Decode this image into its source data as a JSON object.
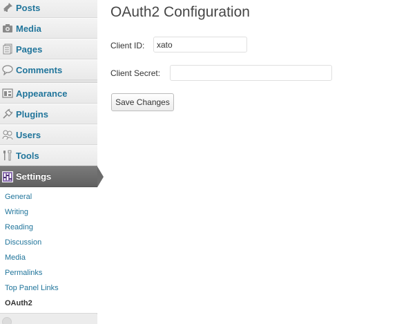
{
  "sidebar": {
    "items": [
      {
        "label": "Posts",
        "icon": "pin-icon"
      },
      {
        "label": "Media",
        "icon": "camera-icon"
      },
      {
        "label": "Pages",
        "icon": "pages-icon"
      },
      {
        "label": "Comments",
        "icon": "comment-bubble-icon"
      },
      {
        "label": "Appearance",
        "icon": "appearance-icon"
      },
      {
        "label": "Plugins",
        "icon": "plug-icon"
      },
      {
        "label": "Users",
        "icon": "users-icon"
      },
      {
        "label": "Tools",
        "icon": "tools-icon"
      },
      {
        "label": "Settings",
        "icon": "settings-icon",
        "active": true
      }
    ],
    "submenu": [
      {
        "label": "General"
      },
      {
        "label": "Writing"
      },
      {
        "label": "Reading"
      },
      {
        "label": "Discussion"
      },
      {
        "label": "Media"
      },
      {
        "label": "Permalinks"
      },
      {
        "label": "Top Panel Links"
      },
      {
        "label": "OAuth2",
        "current": true
      }
    ]
  },
  "main": {
    "title": "OAuth2 Configuration",
    "client_id": {
      "label": "Client ID:",
      "value": "xato"
    },
    "client_secret": {
      "label": "Client Secret:",
      "value": ""
    },
    "save_label": "Save Changes"
  },
  "colors": {
    "link": "#21759b",
    "active_menu": "#6c6c6c",
    "sidebar_bg": "#ececec"
  }
}
